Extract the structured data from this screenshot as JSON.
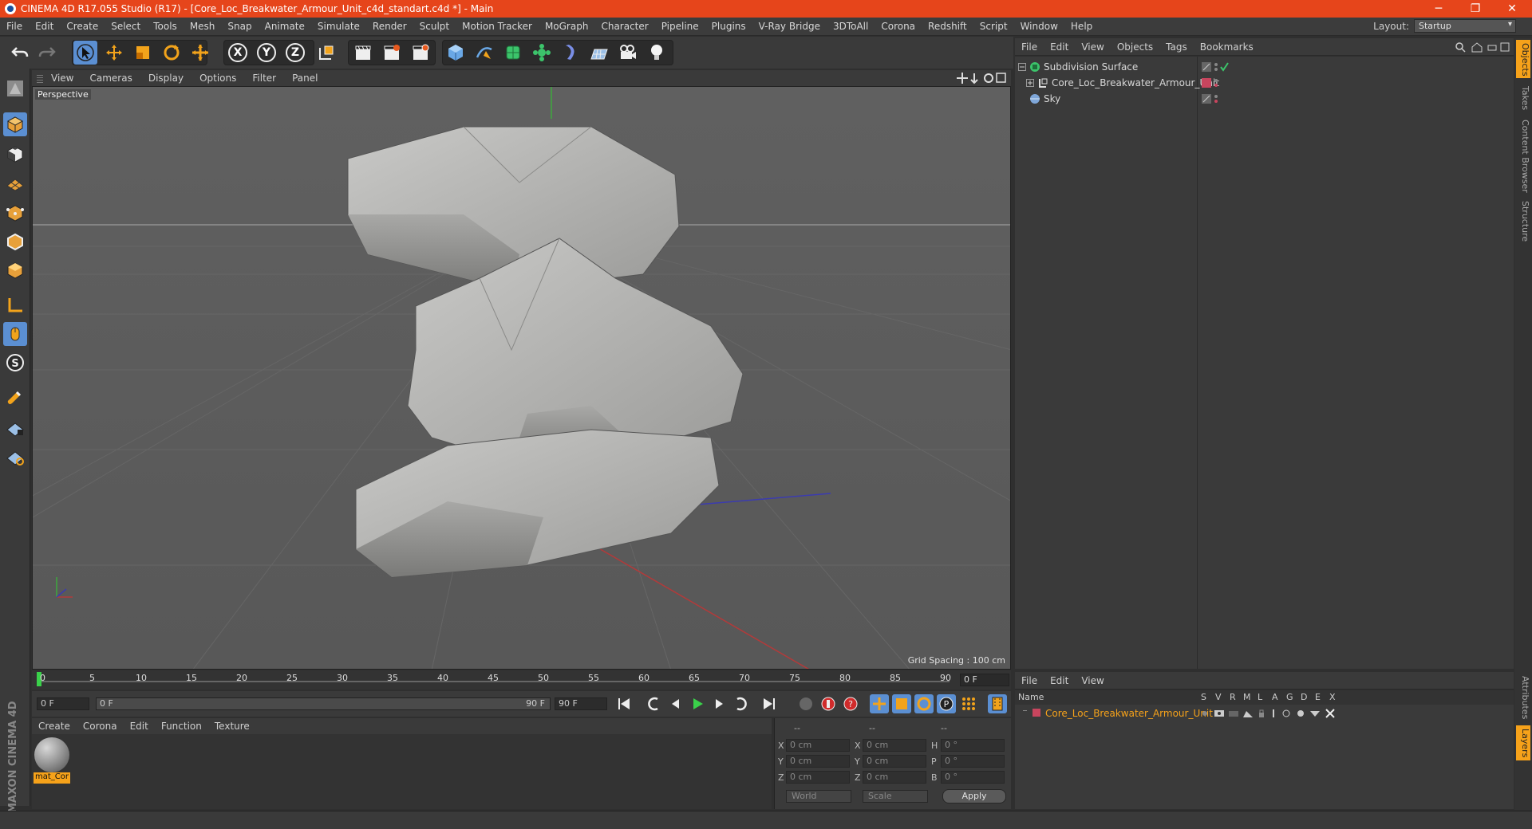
{
  "window": {
    "title": "CINEMA 4D R17.055 Studio (R17) - [Core_Loc_Breakwater_Armour_Unit_c4d_standart.c4d *] - Main",
    "controls": [
      "─",
      "❐",
      "✕"
    ]
  },
  "menubar": {
    "items": [
      "File",
      "Edit",
      "Create",
      "Select",
      "Tools",
      "Mesh",
      "Snap",
      "Animate",
      "Simulate",
      "Render",
      "Sculpt",
      "Motion Tracker",
      "MoGraph",
      "Character",
      "Pipeline",
      "Plugins",
      "V-Ray Bridge",
      "3DToAll",
      "Corona",
      "Redshift",
      "Script",
      "Window",
      "Help"
    ],
    "layout_label": "Layout:",
    "layout_value": "Startup"
  },
  "toolbar": {
    "axis_letters": [
      "X",
      "Y",
      "Z"
    ]
  },
  "viewport": {
    "menu": [
      "View",
      "Cameras",
      "Display",
      "Options",
      "Filter",
      "Panel"
    ],
    "label": "Perspective",
    "grid_spacing": "Grid Spacing : 100 cm"
  },
  "timeline": {
    "ticks": [
      "0",
      "5",
      "10",
      "15",
      "20",
      "25",
      "30",
      "35",
      "40",
      "45",
      "50",
      "55",
      "60",
      "65",
      "70",
      "75",
      "80",
      "85",
      "90"
    ],
    "current_frame": "0 F"
  },
  "transport": {
    "start_field": "0 F",
    "range_start": "0 F",
    "range_end": "90 F",
    "end_field": "90 F"
  },
  "material_manager": {
    "menu": [
      "Create",
      "Corona",
      "Edit",
      "Function",
      "Texture"
    ],
    "materials": [
      {
        "name": "mat_Cor"
      }
    ]
  },
  "coordinates": {
    "headers": [
      "--",
      "--",
      "--"
    ],
    "rows": [
      {
        "pos_label": "X",
        "pos": "0 cm",
        "size_label": "X",
        "size": "0 cm",
        "rot_label": "H",
        "rot": "0 °"
      },
      {
        "pos_label": "Y",
        "pos": "0 cm",
        "size_label": "Y",
        "size": "0 cm",
        "rot_label": "P",
        "rot": "0 °"
      },
      {
        "pos_label": "Z",
        "pos": "0 cm",
        "size_label": "Z",
        "size": "0 cm",
        "rot_label": "B",
        "rot": "0 °"
      }
    ],
    "mode_dropdown": "World",
    "scale_dropdown": "Scale",
    "apply_label": "Apply"
  },
  "object_manager": {
    "menu": [
      "File",
      "Edit",
      "View",
      "Objects",
      "Tags",
      "Bookmarks"
    ],
    "objects": [
      {
        "name": "Subdivision Surface",
        "color": "#3cc46b"
      },
      {
        "name": "Core_Loc_Breakwater_Armour_Unit",
        "color": "#d9d9d9"
      },
      {
        "name": "Sky",
        "color": "#7fa7d9"
      }
    ],
    "layer_color": "#c8455e"
  },
  "layer_manager": {
    "menu": [
      "File",
      "Edit",
      "View"
    ],
    "columns": [
      "Name",
      "S",
      "V",
      "R",
      "M",
      "L",
      "A",
      "G",
      "D",
      "E",
      "X"
    ],
    "layers": [
      {
        "name": "Core_Loc_Breakwater_Armour_Unit",
        "color": "#c8455e"
      }
    ]
  },
  "right_tabs": [
    "Objects",
    "Takes",
    "Content Browser",
    "Structure"
  ],
  "right_tabs_bottom": [
    "Attributes",
    "Layers"
  ],
  "branding": "MAXON CINEMA 4D"
}
